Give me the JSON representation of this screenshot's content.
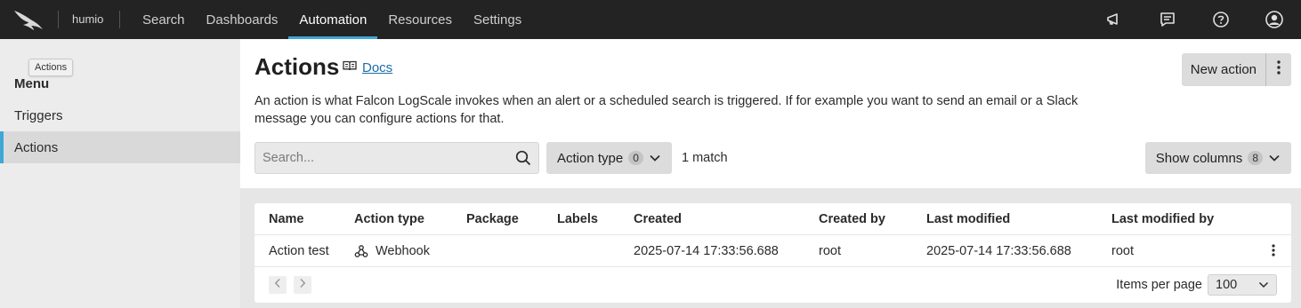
{
  "app": {
    "brand": "humio",
    "nav": [
      {
        "label": "Search",
        "active": false
      },
      {
        "label": "Dashboards",
        "active": false
      },
      {
        "label": "Automation",
        "active": true
      },
      {
        "label": "Resources",
        "active": false
      },
      {
        "label": "Settings",
        "active": false
      }
    ],
    "icons": [
      "megaphone-icon",
      "feedback-icon",
      "help-icon",
      "user-account-icon"
    ]
  },
  "sidebar": {
    "tooltip": "Actions",
    "menu_title": "Menu",
    "items": [
      {
        "label": "Triggers",
        "active": false
      },
      {
        "label": "Actions",
        "active": true
      }
    ]
  },
  "page": {
    "title": "Actions",
    "docs_label": "Docs",
    "description": "An action is what Falcon LogScale invokes when an alert or a scheduled search is triggered. If for example you want to send an email or a Slack message you can configure actions for that.",
    "new_action_label": "New action"
  },
  "toolbar": {
    "search_placeholder": "Search...",
    "action_type_label": "Action type",
    "action_type_count": "0",
    "match_text": "1 match",
    "show_columns_label": "Show columns",
    "show_columns_count": "8"
  },
  "table": {
    "headers": [
      "Name",
      "Action type",
      "Package",
      "Labels",
      "Created",
      "Created by",
      "Last modified",
      "Last modified by"
    ],
    "rows": [
      {
        "name": "Action test",
        "action_type": "Webhook",
        "package": "",
        "labels": "",
        "created": "2025-07-14 17:33:56.688",
        "created_by": "root",
        "last_modified": "2025-07-14 17:33:56.688",
        "last_modified_by": "root"
      }
    ],
    "items_per_page_label": "Items per page",
    "items_per_page_value": "100"
  },
  "colors": {
    "topbar": "#232323",
    "accent": "#3ea7d6",
    "link": "#1a6ea8"
  }
}
